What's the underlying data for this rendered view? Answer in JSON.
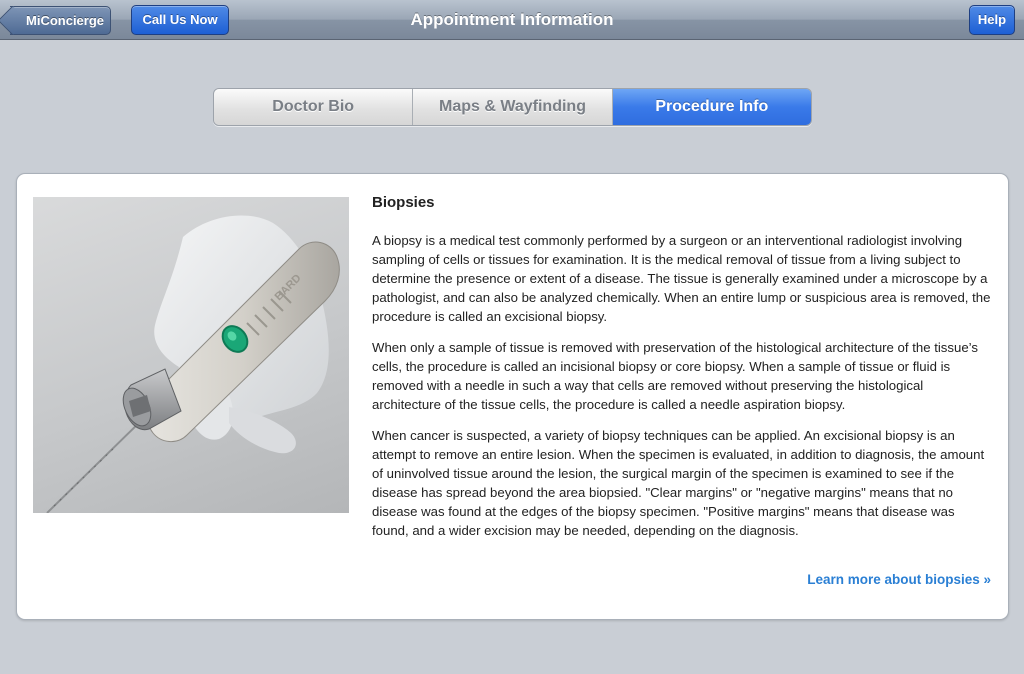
{
  "navbar": {
    "back_label": "MiConcierge",
    "call_label": "Call Us Now",
    "title": "Appointment Information",
    "help_label": "Help"
  },
  "tabs": [
    {
      "label": "Doctor Bio",
      "active": false
    },
    {
      "label": "Maps & Wayfinding",
      "active": false
    },
    {
      "label": "Procedure Info",
      "active": true
    }
  ],
  "article": {
    "heading": "Biopsies",
    "paragraphs": [
      "A biopsy is a medical test commonly performed by a surgeon or an interventional radiologist involving sampling of cells or tissues for examination. It is the medical removal of tissue from a living subject to determine the presence or extent of a disease. The tissue is generally examined under a microscope by a pathologist, and can also be analyzed chemically. When an entire lump or suspicious area is removed, the procedure is called an excisional biopsy.",
      "When only a sample of tissue is removed with preservation of the histological architecture of the tissue’s cells, the procedure is called an incisional biopsy or core biopsy. When a sample of tissue or fluid is removed with a needle in such a way that cells are removed without preserving the histological architecture of the tissue cells, the procedure is called a needle aspiration biopsy.",
      "When cancer is suspected, a variety of biopsy techniques can be applied. An excisional biopsy is an attempt to remove an entire lesion. When the specimen is evaluated, in addition to diagnosis, the amount of uninvolved tissue around the lesion, the surgical margin of the specimen is examined to see if the disease has spread beyond the area biopsied. \"Clear margins\" or \"negative margins\" means that no disease was found at the edges of the biopsy specimen. \"Positive margins\" means that disease was found, and a wider excision may be needed, depending on the diagnosis."
    ],
    "learn_more": "Learn more about biopsies »",
    "image_text": "BARD"
  },
  "colors": {
    "nav_button": "#2d6ee0",
    "active_tab": "#3a7ae9",
    "link": "#2a7fd4"
  }
}
